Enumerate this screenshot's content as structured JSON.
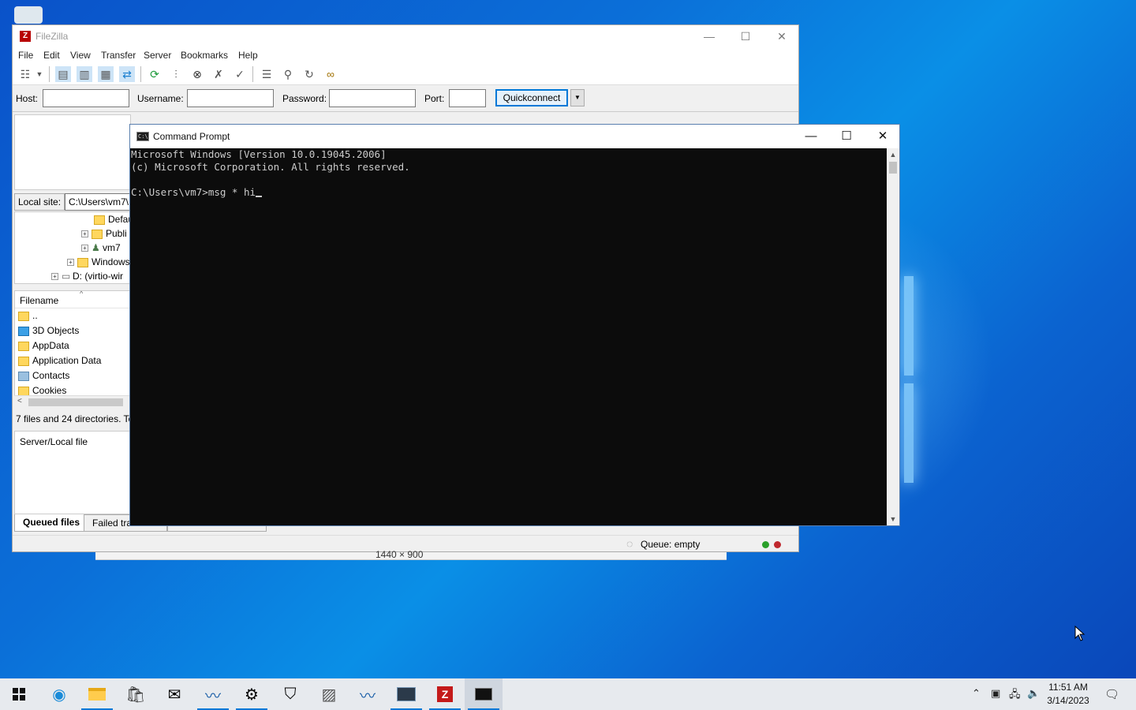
{
  "filezilla": {
    "title": "FileZilla",
    "menu": [
      "File",
      "Edit",
      "View",
      "Transfer",
      "Server",
      "Bookmarks",
      "Help"
    ],
    "quickconnect": {
      "host_label": "Host:",
      "host_value": "",
      "username_label": "Username:",
      "username_value": "",
      "password_label": "Password:",
      "password_value": "",
      "port_label": "Port:",
      "port_value": "",
      "button": "Quickconnect"
    },
    "local_site_label": "Local site:",
    "local_path": "C:\\Users\\vm7\\",
    "tree": [
      "Defau",
      "Publi",
      "vm7",
      "Windows",
      "D: (virtio-wir"
    ],
    "files_header": "Filename",
    "files": [
      "..",
      "3D Objects",
      "AppData",
      "Application Data",
      "Contacts",
      "Cookies"
    ],
    "local_status": "7 files and 24 directories. To",
    "queue_header": "Server/Local file",
    "tabs": [
      "Queued files",
      "Failed tra"
    ],
    "queue_status": "Queue: empty",
    "colors": {
      "ok_dot": "#2aa02a",
      "err_dot": "#c0282e",
      "brand": "#b80000"
    }
  },
  "behind_window_text": "1440 × 900",
  "cmd": {
    "title": "Command Prompt",
    "lines": [
      "Microsoft Windows [Version 10.0.19045.2006]",
      "(c) Microsoft Corporation. All rights reserved.",
      "",
      "C:\\Users\\vm7>msg * hi"
    ]
  },
  "taskbar": {
    "apps": [
      "start-icon",
      "edge-icon",
      "file-explorer-icon",
      "store-icon",
      "mail-icon",
      "dolphin-icon",
      "settings-icon",
      "security-icon",
      "app-icon",
      "dolphin-icon",
      "terminal-icon",
      "filezilla-icon",
      "command-prompt-icon"
    ],
    "time": "11:51 AM",
    "date": "3/14/2023"
  }
}
